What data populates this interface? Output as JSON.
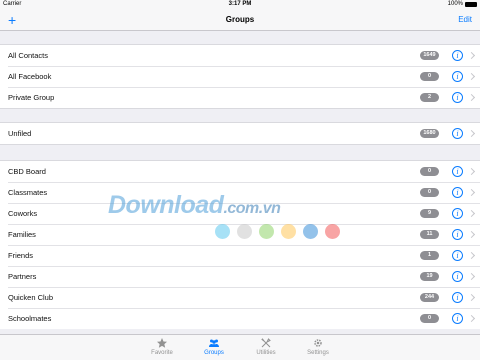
{
  "status_bar": {
    "carrier": "Carrier",
    "time": "3:17 PM",
    "battery": "100%"
  },
  "nav": {
    "add_label": "+",
    "title": "Groups",
    "edit_label": "Edit"
  },
  "sections": [
    {
      "rows": [
        {
          "label": "All Contacts",
          "count": "1649"
        },
        {
          "label": "All Facebook",
          "count": "0"
        },
        {
          "label": "Private Group",
          "count": "2"
        }
      ]
    },
    {
      "rows": [
        {
          "label": "Unfiled",
          "count": "1680"
        }
      ]
    },
    {
      "rows": [
        {
          "label": "CBD Board",
          "count": "0"
        },
        {
          "label": "Classmates",
          "count": "0"
        },
        {
          "label": "Coworks",
          "count": "9"
        },
        {
          "label": "Families",
          "count": "11"
        },
        {
          "label": "Friends",
          "count": "1"
        },
        {
          "label": "Partners",
          "count": "19"
        },
        {
          "label": "Quicken Club",
          "count": "244"
        },
        {
          "label": "Schoolmates",
          "count": "0"
        }
      ]
    }
  ],
  "info_glyph": "i",
  "watermark": {
    "text": "Download",
    "suffix": ".com.vn"
  },
  "watermark_dot_colors": [
    "#5ec8ee",
    "#c8c8c8",
    "#8fd36a",
    "#ffc65a",
    "#3a8fd8",
    "#f25a5a"
  ],
  "tabs": [
    {
      "label": "Favorite",
      "icon": "star-icon",
      "active": false
    },
    {
      "label": "Groups",
      "icon": "people-icon",
      "active": true
    },
    {
      "label": "Utilities",
      "icon": "tools-icon",
      "active": false
    },
    {
      "label": "Settings",
      "icon": "gear-icon",
      "active": false
    }
  ],
  "colors": {
    "accent": "#0a7cff",
    "badge": "#8e8e93",
    "background": "#efeff4"
  }
}
